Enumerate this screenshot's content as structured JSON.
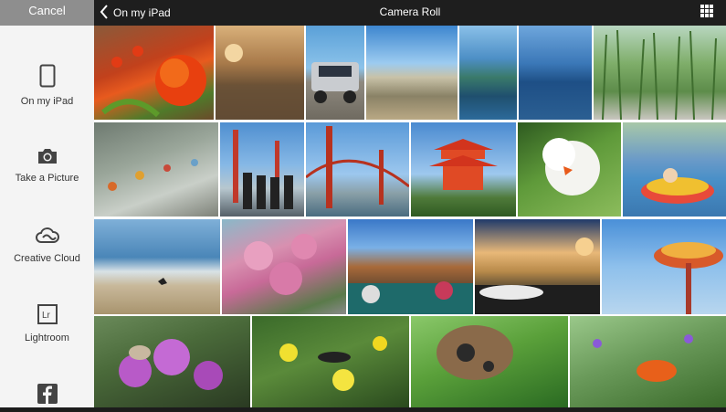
{
  "sidebar": {
    "cancel_label": "Cancel",
    "items": [
      {
        "label": "On my iPad",
        "icon": "ipad-icon"
      },
      {
        "label": "Take a Picture",
        "icon": "camera-icon"
      },
      {
        "label": "Creative Cloud",
        "icon": "creative-cloud-icon"
      },
      {
        "label": "Lightroom",
        "icon": "lightroom-icon"
      },
      {
        "label": "",
        "icon": "facebook-icon"
      }
    ]
  },
  "header": {
    "back_label": "On my iPad",
    "title": "Camera Roll",
    "view_icon": "grid-icon"
  },
  "photos": [
    {
      "subject": "red tulips"
    },
    {
      "subject": "sunset lake"
    },
    {
      "subject": "vintage truck"
    },
    {
      "subject": "coastal hills"
    },
    {
      "subject": "rocky coast"
    },
    {
      "subject": "blue sea cliffs"
    },
    {
      "subject": "tall grass"
    },
    {
      "subject": "aquarium toys"
    },
    {
      "subject": "golden gate group"
    },
    {
      "subject": "golden gate bridge"
    },
    {
      "subject": "red pagoda"
    },
    {
      "subject": "white lily with butterfly"
    },
    {
      "subject": "bumper boat"
    },
    {
      "subject": "beach with bird"
    },
    {
      "subject": "pink blossoms"
    },
    {
      "subject": "convertible canyon drive"
    },
    {
      "subject": "convertible sunset road"
    },
    {
      "subject": "swing ride"
    },
    {
      "subject": "purple verbena butterfly"
    },
    {
      "subject": "yellow flowers butterfly"
    },
    {
      "subject": "owl butterfly on leaf"
    },
    {
      "subject": "orange butterfly on flowers"
    }
  ]
}
